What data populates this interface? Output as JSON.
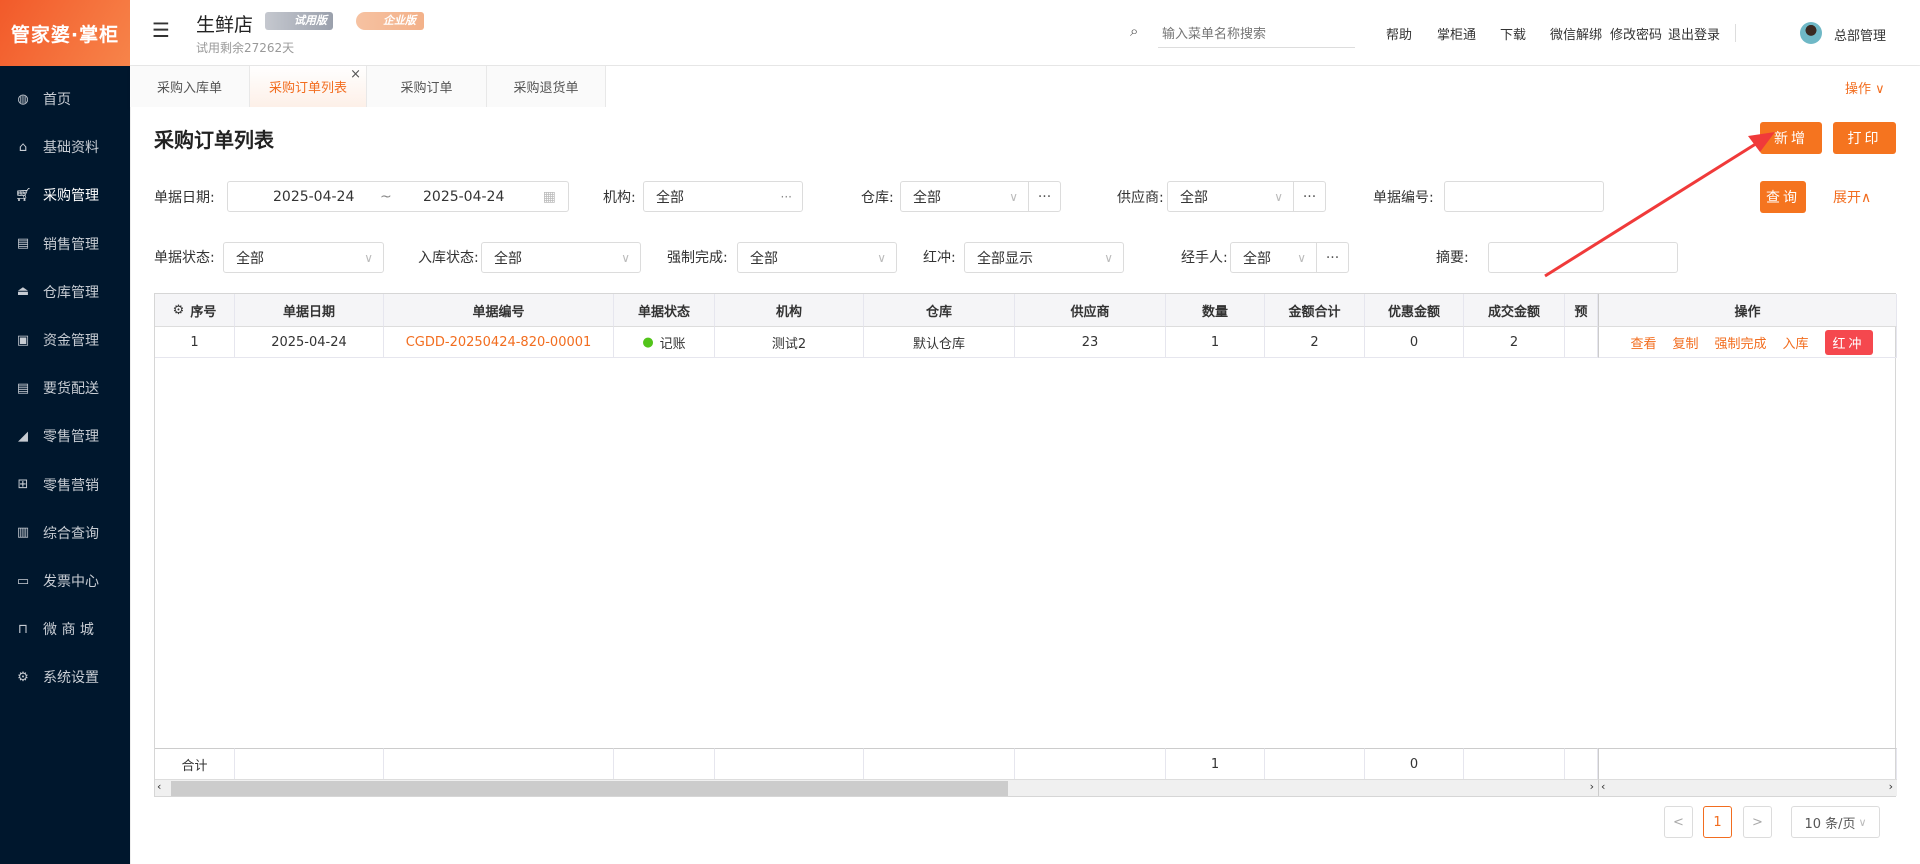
{
  "sidebar": {
    "logo": "管家婆·掌柜",
    "items": [
      {
        "label": "首页",
        "icon": "globe-icon",
        "glyph": "◍"
      },
      {
        "label": "基础资料",
        "icon": "home-icon",
        "glyph": "⌂"
      },
      {
        "label": "采购管理",
        "icon": "cart-icon",
        "glyph": "🛒︎"
      },
      {
        "label": "销售管理",
        "icon": "calendar-icon",
        "glyph": "▤"
      },
      {
        "label": "仓库管理",
        "icon": "bank-icon",
        "glyph": "⏏"
      },
      {
        "label": "资金管理",
        "icon": "wallet-icon",
        "glyph": "▣"
      },
      {
        "label": "要货配送",
        "icon": "list-icon",
        "glyph": "▤"
      },
      {
        "label": "零售管理",
        "icon": "area-chart-icon",
        "glyph": "◢"
      },
      {
        "label": "零售营销",
        "icon": "gift-icon",
        "glyph": "⊞"
      },
      {
        "label": "综合查询",
        "icon": "bar-chart-icon",
        "glyph": "▥"
      },
      {
        "label": "发票中心",
        "icon": "line-chart-icon",
        "glyph": "▭"
      },
      {
        "label": "微 商 城",
        "icon": "bag-icon",
        "glyph": "⊓"
      },
      {
        "label": "系统设置",
        "icon": "gear-icon",
        "glyph": "⚙"
      }
    ],
    "active": 2
  },
  "header": {
    "store": "生鲜店",
    "badge_trial": "试用版",
    "badge_enterprise": "企业版",
    "trial_remaining": "试用剩余27262天",
    "search_placeholder": "输入菜单名称搜索",
    "links": [
      "帮助",
      "掌柜通",
      "下载",
      "微信解绑",
      "修改密码",
      "退出登录"
    ],
    "user": "总部管理"
  },
  "tabs": {
    "items": [
      "采购入库单",
      "采购订单列表",
      "采购订单",
      "采购退货单"
    ],
    "active": 1,
    "ops": "操作 ∨"
  },
  "page": {
    "title": "采购订单列表",
    "add": "新增",
    "print": "打印",
    "query": "查询",
    "expand": "展开∧"
  },
  "filters": {
    "date_label": "单据日期:",
    "date_from": "2025-04-24",
    "date_sep": "~",
    "date_to": "2025-04-24",
    "org_label": "机构:",
    "org": "全部",
    "wh_label": "仓库:",
    "wh": "全部",
    "supplier_label": "供应商:",
    "supplier": "全部",
    "no_label": "单据编号:",
    "no": "",
    "status_label": "单据状态:",
    "status": "全部",
    "instock_label": "入库状态:",
    "instock": "全部",
    "force_label": "强制完成:",
    "force": "全部",
    "red_label": "红冲:",
    "red": "全部显示",
    "handler_label": "经手人:",
    "handler": "全部",
    "memo_label": "摘要:",
    "memo": ""
  },
  "table": {
    "columns": [
      "序号",
      "单据日期",
      "单据编号",
      "单据状态",
      "机构",
      "仓库",
      "供应商",
      "数量",
      "金额合计",
      "优惠金额",
      "成交金额",
      "预"
    ],
    "op_header": "操作",
    "rows": [
      {
        "cells": [
          "1",
          "2025-04-24",
          "CGDD-20250424-820-00001",
          "记账",
          "测试2",
          "默认仓库",
          "23",
          "1",
          "2",
          "0",
          "2",
          ""
        ]
      }
    ],
    "ops": [
      "查看",
      "复制",
      "强制完成",
      "入库",
      "红冲"
    ],
    "footer": [
      "合计",
      "",
      "",
      "",
      "",
      "",
      "",
      "1",
      "",
      "0",
      "",
      ""
    ]
  },
  "pagination": {
    "prev": "<",
    "page": "1",
    "next": ">",
    "size": "10 条/页"
  }
}
